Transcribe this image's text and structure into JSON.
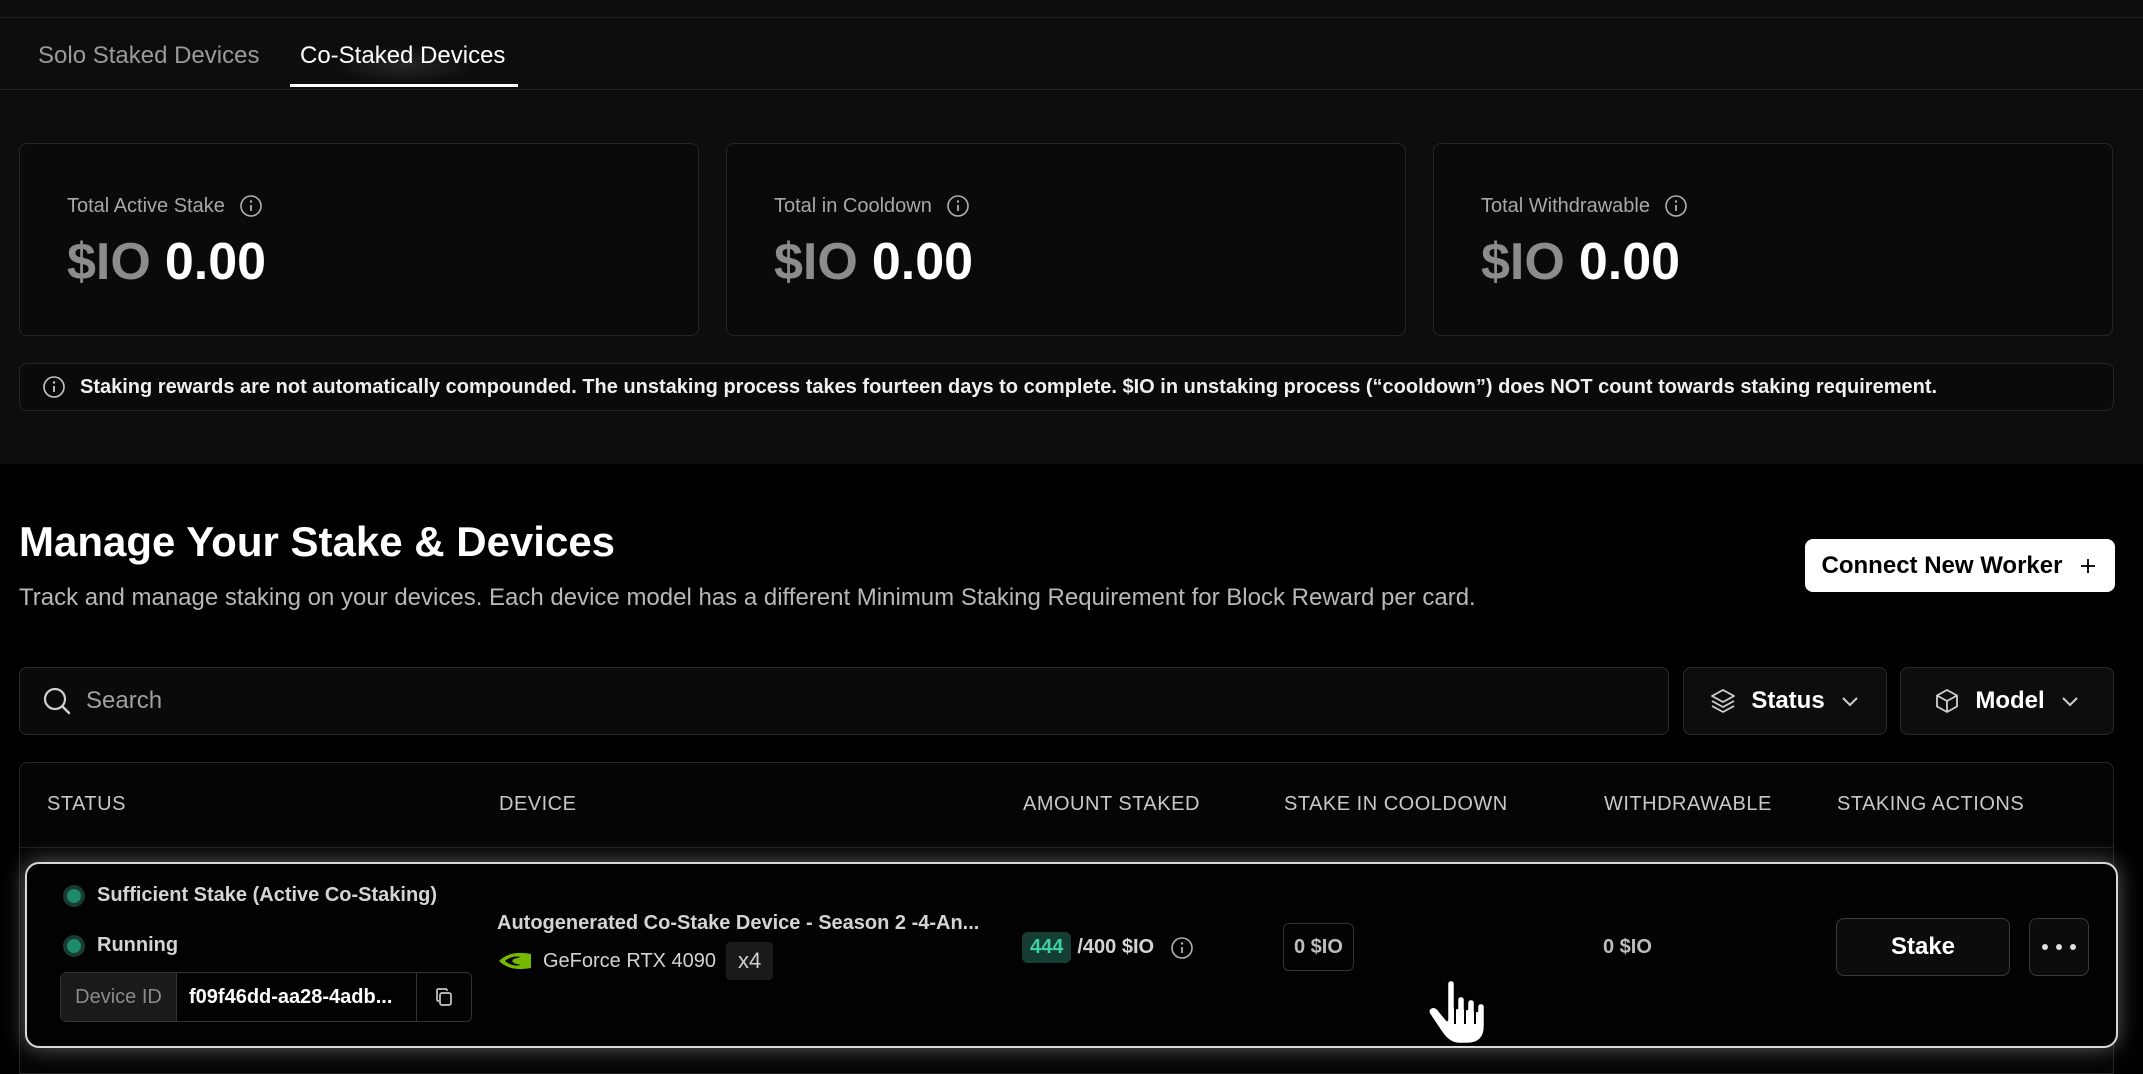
{
  "tabs": [
    {
      "label": "Solo Staked Devices",
      "active": false
    },
    {
      "label": "Co-Staked Devices",
      "active": true
    }
  ],
  "summary_cards": [
    {
      "label": "Total Active Stake",
      "currency": "$IO",
      "value": "0.00"
    },
    {
      "label": "Total in Cooldown",
      "currency": "$IO",
      "value": "0.00"
    },
    {
      "label": "Total Withdrawable",
      "currency": "$IO",
      "value": "0.00"
    }
  ],
  "notice": {
    "text": "Staking rewards are not automatically compounded. The unstaking process takes fourteen days to complete. $IO in unstaking process (“cooldown”) does NOT count towards staking requirement."
  },
  "section": {
    "title": "Manage Your Stake & Devices",
    "subtitle": "Track and manage staking on your devices. Each device model has a different Minimum Staking Requirement for Block Reward per card.",
    "connect_label": "Connect New Worker"
  },
  "search": {
    "placeholder": "Search",
    "value": ""
  },
  "filters": {
    "status_label": "Status",
    "model_label": "Model"
  },
  "table": {
    "headers": [
      "STATUS",
      "DEVICE",
      "AMOUNT STAKED",
      "STAKE IN COOLDOWN",
      "WITHDRAWABLE",
      "STAKING ACTIONS"
    ],
    "rows": [
      {
        "status_primary": "Sufficient Stake (Active Co-Staking)",
        "status_secondary": "Running",
        "device_id_label": "Device ID",
        "device_id": "f09f46dd-aa28-4adb...",
        "device_name": "Autogenerated Co-Stake Device - Season 2 -4-An...",
        "gpu_model": "GeForce RTX 4090",
        "gpu_count": "x4",
        "amount_staked": "444",
        "amount_required": "/400 $IO",
        "stake_in_cooldown": "0 $IO",
        "withdrawable": "0 $IO",
        "stake_label": "Stake"
      }
    ]
  },
  "colors": {
    "accent_green": "#3fd1a2",
    "badge_bg": "#163d33",
    "status_dot": "#1d8a6c",
    "nvidia_green": "#76b900"
  }
}
